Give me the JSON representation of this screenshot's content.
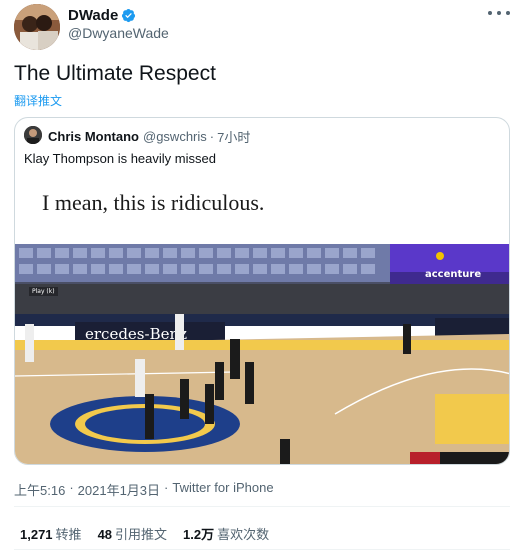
{
  "author": {
    "display_name": "DWade",
    "handle": "@DwyaneWade",
    "verified": true
  },
  "tweet": {
    "text": "The Ultimate Respect",
    "translate_label": "翻译推文"
  },
  "quoted_tweet": {
    "display_name": "Chris Montano",
    "handle": "@gswchris",
    "separator": "·",
    "time": "7小时",
    "text": "Klay Thompson is heavily missed",
    "media_caption": "I mean, this is ridiculous.",
    "media_play_label": "Play (k)"
  },
  "meta": {
    "time": "上午5:16",
    "separator": "·",
    "date": "2021年1月3日",
    "source": "Twitter for iPhone"
  },
  "stats": {
    "retweets_count": "1,271",
    "retweets_label": "转推",
    "quotes_count": "48",
    "quotes_label": "引用推文",
    "likes_count": "1.2万",
    "likes_label": "喜欢次数"
  },
  "icons": {
    "verified": "verified-badge-icon",
    "more": "more-icon"
  },
  "colors": {
    "link": "#1d9bf0",
    "verified": "#1d9bf0",
    "secondary_text": "#536471"
  }
}
